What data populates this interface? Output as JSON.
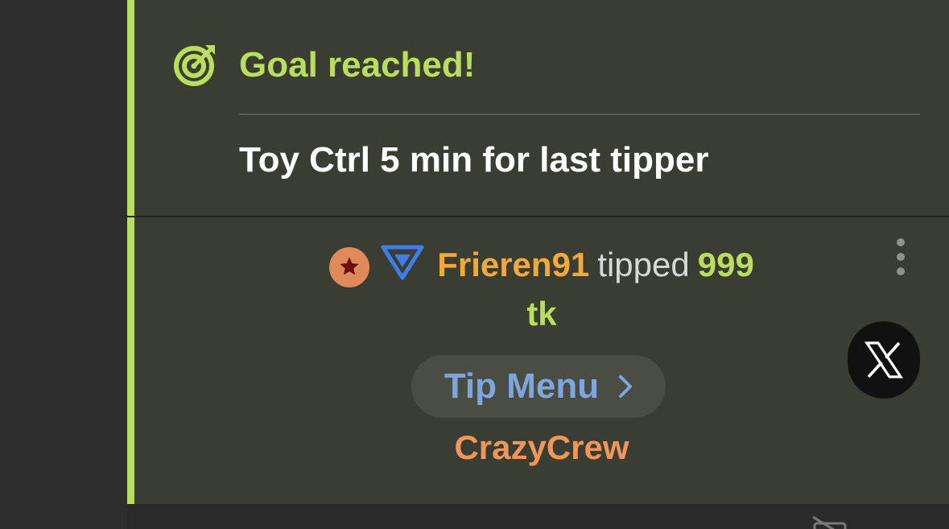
{
  "goal": {
    "icon": "target-icon",
    "title": "Goal reached!",
    "description": "Toy Ctrl 5 min for last tipper"
  },
  "tip": {
    "user_badge_icon": "star-badge-icon",
    "rank_icon": "triangle-rank-icon",
    "username": "Frieren91",
    "action": "tipped",
    "amount": "999",
    "unit": "tk",
    "menu_button": "Tip Menu",
    "menu_icon": "chevron-right-icon",
    "source": "CrazyCrew",
    "more_icon": "more-vertical-icon",
    "share_icon": "x-logo-icon"
  },
  "bottom_bar": {
    "partial_text": "",
    "icon": "no-video-icon"
  },
  "colors": {
    "accent_green": "#b9dd5e",
    "username_orange": "#f2a93b",
    "tip_menu_blue": "#7ea6dc",
    "source_orange": "#f0965a"
  }
}
